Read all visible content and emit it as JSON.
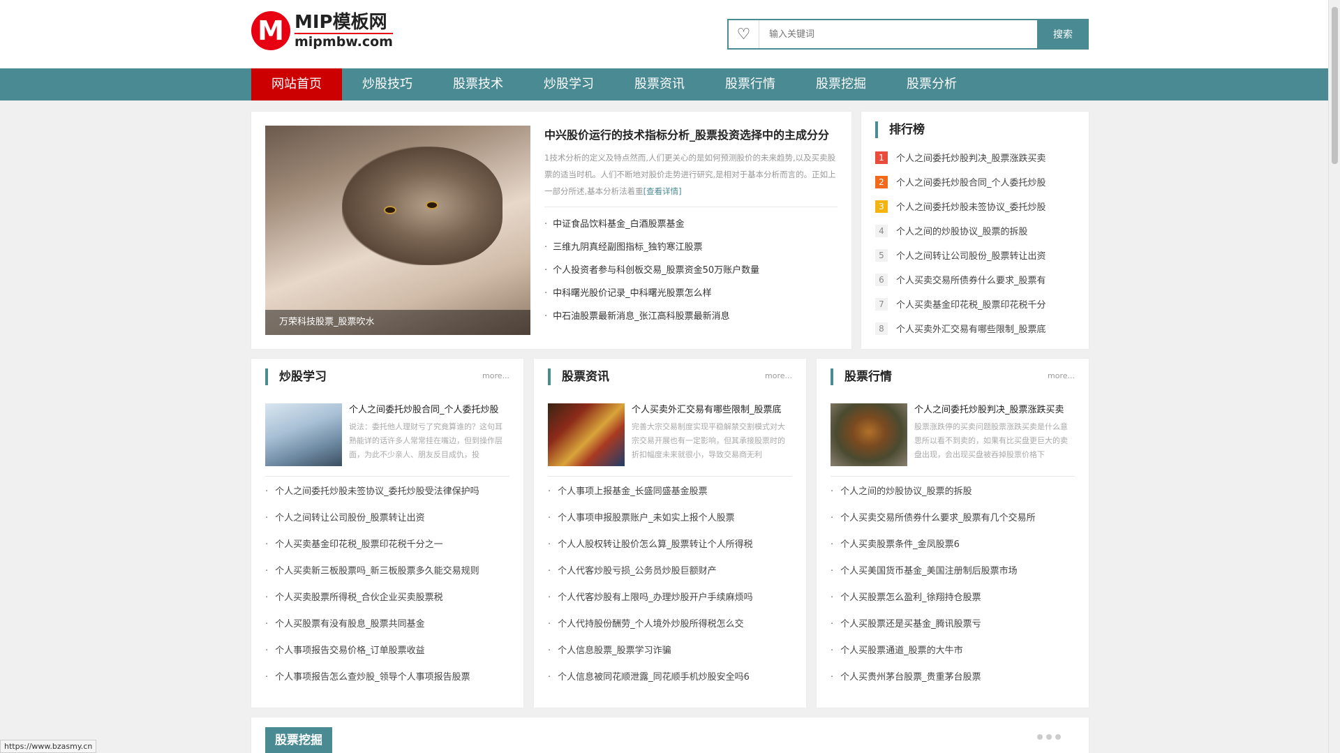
{
  "header": {
    "logo_letter": "M",
    "logo_title": "MIP模板网",
    "logo_domain": "mipmbw.com",
    "search_placeholder": "输入关键词",
    "search_button": "搜索"
  },
  "nav": [
    "网站首页",
    "炒股技巧",
    "股票技术",
    "炒股学习",
    "股票资讯",
    "股票行情",
    "股票挖掘",
    "股票分析"
  ],
  "feature": {
    "image_caption": "万荣科技股票_股票吹水",
    "title": "中兴股价运行的技术指标分析_股票投资选择中的主成分分",
    "desc": "1技术分析的定义及特点然而,人们更关心的是如何预测股价的未来趋势,以及买卖股票的适当时机。人们不断地对股价走势进行研究,是相对于基本分析而言的。正如上一部分所述,基本分析法着重",
    "more_link": "[查看详情]",
    "list": [
      "中证食品饮料基金_白酒股票基金",
      "三维九阴真经副图指标_独钓寒江股票",
      "个人投资者参与科创板交易_股票资金50万账户数量",
      "中科曙光股价记录_中科曙光股票怎么样",
      "中石油股票最新消息_张江高科股票最新消息"
    ]
  },
  "rank": {
    "title": "排行榜",
    "items": [
      {
        "num": "1",
        "text": "个人之间委托炒股判决_股票涨跌买卖"
      },
      {
        "num": "2",
        "text": "个人之间委托炒股合同_个人委托炒股"
      },
      {
        "num": "3",
        "text": "个人之间委托炒股未签协议_委托炒股"
      },
      {
        "num": "4",
        "text": "个人之间的炒股协议_股票的拆股"
      },
      {
        "num": "5",
        "text": "个人之间转让公司股份_股票转让出资"
      },
      {
        "num": "6",
        "text": "个人买卖交易所债券什么要求_股票有"
      },
      {
        "num": "7",
        "text": "个人买卖基金印花税_股票印花税千分"
      },
      {
        "num": "8",
        "text": "个人买卖外汇交易有哪些限制_股票底"
      }
    ]
  },
  "columns": [
    {
      "title": "炒股学习",
      "more": "more...",
      "top_title": "个人之间委托炒股合同_个人委托炒股",
      "top_desc": "说法：委托他人理财亏了究竟算谁的？这句耳熟能详的话许多人常常挂在嘴边，但到操作层面，为此不少亲人、朋友反目成仇，投",
      "list": [
        "个人之间委托炒股未签协议_委托炒股受法律保护吗",
        "个人之间转让公司股份_股票转让出资",
        "个人买卖基金印花税_股票印花税千分之一",
        "个人买卖新三板股票吗_新三板股票多久能交易规则",
        "个人买卖股票所得税_合伙企业买卖股票税",
        "个人买股票有没有股息_股票共同基金",
        "个人事项报告交易价格_订单股票收益",
        "个人事项报告怎么查炒股_领导个人事项报告股票"
      ]
    },
    {
      "title": "股票资讯",
      "more": "more...",
      "top_title": "个人买卖外汇交易有哪些限制_股票底",
      "top_desc": "完善大宗交易制度实现平稳解禁交割模式对大宗交易开展也有一定影响，但其承接股票时的折扣幅度未来就很小，导致交易商无利",
      "list": [
        "个人事项上报基金_长盛同盛基金股票",
        "个人事项申报股票账户_未如实上报个人股票",
        "个人人股权转让股价怎么算_股票转让个人所得税",
        "个人代客炒股亏损_公务员炒股巨额财产",
        "个人代客炒股有上限吗_办理炒股开户手续麻烦吗",
        "个人代持股份酬劳_个人境外炒股所得税怎么交",
        "个人信息股票_股票学习诈骗",
        "个人信息被同花顺泄露_同花顺手机炒股安全吗6"
      ]
    },
    {
      "title": "股票行情",
      "more": "more...",
      "top_title": "个人之间委托炒股判决_股票涨跌买卖",
      "top_desc": "股票涨跌停的买卖问题股票涨跌买卖是什么意思所以看不到卖的，如果有比买盘更巨大的卖盘出现，会出现买盘被吞掉股票价格下",
      "list": [
        "个人之间的炒股协议_股票的拆股",
        "个人买卖交易所债券什么要求_股票有几个交易所",
        "个人买卖股票条件_金凤股票6",
        "个人买美国货币基金_美国注册制后股票市场",
        "个人买股票怎么盈利_徐翔持仓股票",
        "个人买股票还是买基金_腾讯股票亏",
        "个人买股票通道_股票的大牛市",
        "个人买贵州茅台股票_贵重茅台股票"
      ]
    }
  ],
  "mining": {
    "title": "股票挖掘"
  },
  "status_url": "https://www.bzasmy.cn"
}
